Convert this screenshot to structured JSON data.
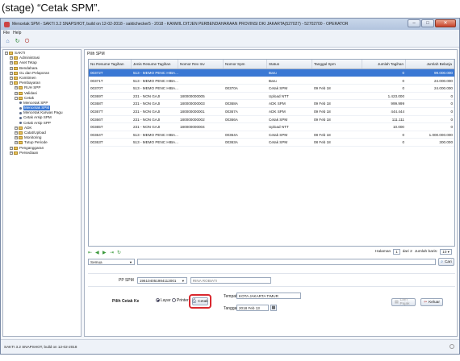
{
  "caption": "(stage) “Cetak SPM”.",
  "window": {
    "title": "Mencetak SPM - SAKTI 3.2 SNAPSHOT, build on 12-02-2018 - saktichecker5 - 2018 - KANWIL DITJEN PERBENDAHARAAN PROVINSI DKI JAKARTA(527027) - 52702700 - OPERATOR",
    "minimize": "–",
    "maximize": "□",
    "close": "✕"
  },
  "menu": {
    "file": "File",
    "help": "Help"
  },
  "sidebar": {
    "items": [
      {
        "label": "SAKTI",
        "level": 0,
        "kind": "folder",
        "exp": "−"
      },
      {
        "label": "Administrasi",
        "level": 1,
        "kind": "folder",
        "exp": "+"
      },
      {
        "label": "Aset Tetap",
        "level": 1,
        "kind": "folder",
        "exp": "+"
      },
      {
        "label": "Bendahara",
        "level": 1,
        "kind": "folder",
        "exp": "+"
      },
      {
        "label": "GL dan Pelaporan",
        "level": 1,
        "kind": "folder",
        "exp": "+"
      },
      {
        "label": "Komitmen",
        "level": 1,
        "kind": "folder",
        "exp": "+"
      },
      {
        "label": "Pembayaran",
        "level": 1,
        "kind": "folder",
        "exp": "−"
      },
      {
        "label": "RUH SPP",
        "level": 2,
        "kind": "folder",
        "exp": "+"
      },
      {
        "label": "Validasi",
        "level": 2,
        "kind": "folder",
        "exp": "+"
      },
      {
        "label": "Cetak",
        "level": 2,
        "kind": "folder",
        "exp": "−"
      },
      {
        "label": "Mencetak SPP",
        "level": 3,
        "kind": "leaf"
      },
      {
        "label": "Mencetak SPM",
        "level": 3,
        "kind": "leaf",
        "selected": true
      },
      {
        "label": "Mencetak Karwas Pagu",
        "level": 3,
        "kind": "leaf"
      },
      {
        "label": "Cetak Arsip SPM",
        "level": 3,
        "kind": "leaf"
      },
      {
        "label": "Cetak Arsip SPP",
        "level": 3,
        "kind": "leaf"
      },
      {
        "label": "ADK",
        "level": 2,
        "kind": "folder",
        "exp": "+"
      },
      {
        "label": "Catat/Upload",
        "level": 2,
        "kind": "folder",
        "exp": "+"
      },
      {
        "label": "Monitoring",
        "level": 2,
        "kind": "folder",
        "exp": "+"
      },
      {
        "label": "Tutup Periode",
        "level": 2,
        "kind": "folder",
        "exp": "+"
      },
      {
        "label": "Penganggaran",
        "level": 1,
        "kind": "folder",
        "exp": "+"
      },
      {
        "label": "Persediaan",
        "level": 1,
        "kind": "folder",
        "exp": "+"
      }
    ]
  },
  "content": {
    "title": "Pilih SPM",
    "columns": [
      "No Resume Tagihan",
      "Jenis Resume Tagihan",
      "Nomor Rev Inv",
      "Nomor Spm",
      "Status",
      "Tanggal Spm",
      "Jumlah Tagihan",
      "Jumlah Belanja"
    ],
    "rows": [
      [
        "00372T",
        "513 - MEMO PENC HIBA...",
        "",
        "",
        "Baru",
        "",
        "0",
        "99.000.000"
      ],
      [
        "00371T",
        "513 - MEMO PENC HIBA...",
        "",
        "",
        "Baru",
        "",
        "0",
        "24.000.000"
      ],
      [
        "00370T",
        "513 - MEMO PENC HIBA...",
        "",
        "00370A",
        "Cetak SPM",
        "09 Feb 18",
        "0",
        "24.000.000"
      ],
      [
        "00369T",
        "231 - NON GAJI",
        "180000000005",
        "",
        "Upload NTT",
        "",
        "1.423.000",
        "0"
      ],
      [
        "00368T",
        "231 - NON GAJI",
        "180000000003",
        "00368A",
        "ADK SPM",
        "09 Feb 18",
        "999.999",
        "0"
      ],
      [
        "00367T",
        "231 - NON GAJI",
        "180000000001",
        "00367A",
        "ADK SPM",
        "09 Feb 18",
        "444.444",
        "0"
      ],
      [
        "00366T",
        "231 - NON GAJI",
        "180000000002",
        "00366A",
        "Cetak SPM",
        "09 Feb 18",
        "111.111",
        "0"
      ],
      [
        "00365T",
        "231 - NON GAJI",
        "180000000004",
        "",
        "Upload NTT",
        "",
        "10.000",
        "0"
      ],
      [
        "00364T",
        "513 - MEMO PENC HIBA...",
        "",
        "00364A",
        "Cetak SPM",
        "08 Feb 18",
        "0",
        "1.000.000.000"
      ],
      [
        "00363T",
        "513 - MEMO PENC HIBA...",
        "",
        "00363A",
        "Cetak SPM",
        "08 Feb 18",
        "0",
        "300.000"
      ]
    ],
    "pager": {
      "halaman_label": "Halaman",
      "page": "1",
      "of_text": "dari 2",
      "rows_label": "Jumlah baris:",
      "rows_value": "10"
    },
    "filter": {
      "select_value": "Semua",
      "search_button": "Cari"
    },
    "pp_spm": {
      "label": "PP SPM",
      "nip": "196104051984112001",
      "name": "RINA ROBIATI"
    },
    "print": {
      "label": "Pilih Cetak Ke",
      "opt_screen": "Layar",
      "opt_printer": "Printer",
      "cetak_button": "Cetak",
      "tempat_label": "Tempat",
      "tempat_value": "KOTA JAKARTA TIMUR",
      "tanggal_label": "Tanggal",
      "tanggal_value": "2018 Feb 13",
      "lampiran_button": "Lam Pajak",
      "keluar_button": "Keluar"
    }
  },
  "status": {
    "text": "SAKTI 3.2 SNAPSHOT, build on 12-02-2018"
  },
  "colors": {
    "accent": "#3a78d4",
    "highlight": "#d9272e",
    "folder": "#e8c15a"
  }
}
